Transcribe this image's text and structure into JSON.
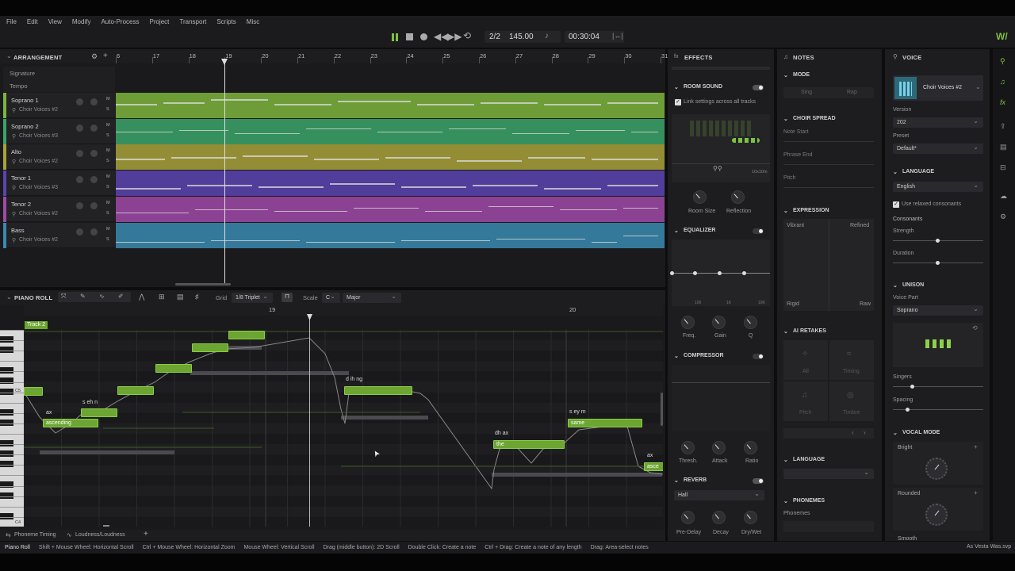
{
  "menu": [
    "File",
    "Edit",
    "View",
    "Modify",
    "Auto-Process",
    "Project",
    "Transport",
    "Scripts",
    "Misc"
  ],
  "transport": {
    "time_sig": "2/2",
    "tempo": "145.00",
    "position": "00:30:04"
  },
  "arrangement": {
    "title": "ARRANGEMENT",
    "signature_label": "Signature",
    "tempo_label": "Tempo",
    "ruler": [
      "6",
      "17",
      "18",
      "19",
      "20",
      "21",
      "22",
      "23",
      "24",
      "25",
      "26",
      "27",
      "28",
      "29",
      "30",
      "31"
    ],
    "tracks": [
      {
        "name": "Soprano 1",
        "voice": "Choir Voices #2",
        "color": "#7db53c"
      },
      {
        "name": "Soprano 2",
        "voice": "Choir Voices #3",
        "color": "#3aa56a"
      },
      {
        "name": "Alto",
        "voice": "Choir Voices #2",
        "color": "#a9a33a"
      },
      {
        "name": "Tenor 1",
        "voice": "Choir Voices #3",
        "color": "#5b44b0"
      },
      {
        "name": "Tenor 2",
        "voice": "Choir Voices #2",
        "color": "#a04aa8"
      },
      {
        "name": "Bass",
        "voice": "Choir Voices #2",
        "color": "#3a8ab0"
      }
    ],
    "mute": "M",
    "solo": "S"
  },
  "piano_roll": {
    "title": "PIANO ROLL",
    "grid_label": "Grid",
    "grid_value": "1/8 Triplet",
    "scale_label": "Scale",
    "scale_key": "C",
    "scale_mode": "Major",
    "track_tag": "Track 2",
    "ruler": [
      "19",
      "20"
    ],
    "key_c5": "C5",
    "key_c4": "C4",
    "notes": [
      {
        "lyric": "ascending",
        "phon": "ax"
      },
      {
        "lyric": "",
        "phon": "s eh n"
      },
      {
        "lyric": "",
        "phon": "d ih ng"
      },
      {
        "lyric": "the",
        "phon": "dh ax"
      },
      {
        "lyric": "same",
        "phon": "s ey m"
      },
      {
        "lyric": "asce",
        "phon": "ax"
      }
    ],
    "bottom_tabs": [
      "Phoneme Timing",
      "Loudness/Loudness"
    ]
  },
  "effects": {
    "title": "EFFECTS",
    "room_sound": "ROOM SOUND",
    "link_settings": "Link settings across all tracks",
    "room_dims": "10x10m",
    "room_size": "Room Size",
    "reflection": "Reflection",
    "equalizer": "EQUALIZER",
    "eq_ticks": [
      "100",
      "1K",
      "10K"
    ],
    "freq": "Freq.",
    "gain": "Gain",
    "q": "Q",
    "compressor": "COMPRESSOR",
    "thresh": "Thresh.",
    "attack": "Attack",
    "ratio": "Ratio",
    "reverb": "REVERB",
    "reverb_type": "Hall",
    "pre_delay": "Pre-Delay",
    "decay": "Decay",
    "dry_wet": "Dry/Wet"
  },
  "notes_panel": {
    "title": "NOTES",
    "mode": "MODE",
    "sing": "Sing",
    "rap": "Rap",
    "choir_spread": "CHOIR SPREAD",
    "note_start": "Note Start",
    "phrase_end": "Phrase End",
    "pitch": "Pitch",
    "expression": "EXPRESSION",
    "vibrant": "Vibrant",
    "refined": "Refined",
    "rigid": "Rigid",
    "raw": "Raw",
    "ai_retakes": "AI RETAKES",
    "retakes": [
      "All",
      "Timing",
      "Pitch",
      "Timbre"
    ],
    "language": "LANGUAGE",
    "phonemes_h": "PHONEMES",
    "phonemes": "Phonemes"
  },
  "voice_panel": {
    "title": "VOICE",
    "voice_name": "Choir Voices #2",
    "version_label": "Version",
    "version": "202",
    "preset_label": "Preset",
    "preset": "Default*",
    "language_h": "LANGUAGE",
    "language": "English",
    "relaxed": "Use relaxed consonants",
    "consonants": "Consonants",
    "strength": "Strength",
    "duration": "Duration",
    "unison": "UNISON",
    "voice_part_label": "Voice Part",
    "voice_part": "Soprano",
    "singers": "Singers",
    "spacing": "Spacing",
    "vocal_mode": "VOCAL MODE",
    "bright": "Bright",
    "rounded": "Rounded",
    "smooth": "Smooth"
  },
  "status": {
    "mode": "Piano Roll",
    "hints": [
      "Shift + Mouse Wheel: Horizontal Scroll",
      "Ctrl + Mouse Wheel: Horizontal Zoom",
      "Mouse Wheel: Vertical Scroll",
      "Drag (middle button): 2D Scroll",
      "Double Click: Create a note",
      "Ctrl + Drag: Create a note of any length",
      "Drag: Area-select notes"
    ],
    "file": "As Vesta Was.svp"
  },
  "colors": {
    "accent": "#7dc242",
    "bg": "#1d1d20"
  }
}
